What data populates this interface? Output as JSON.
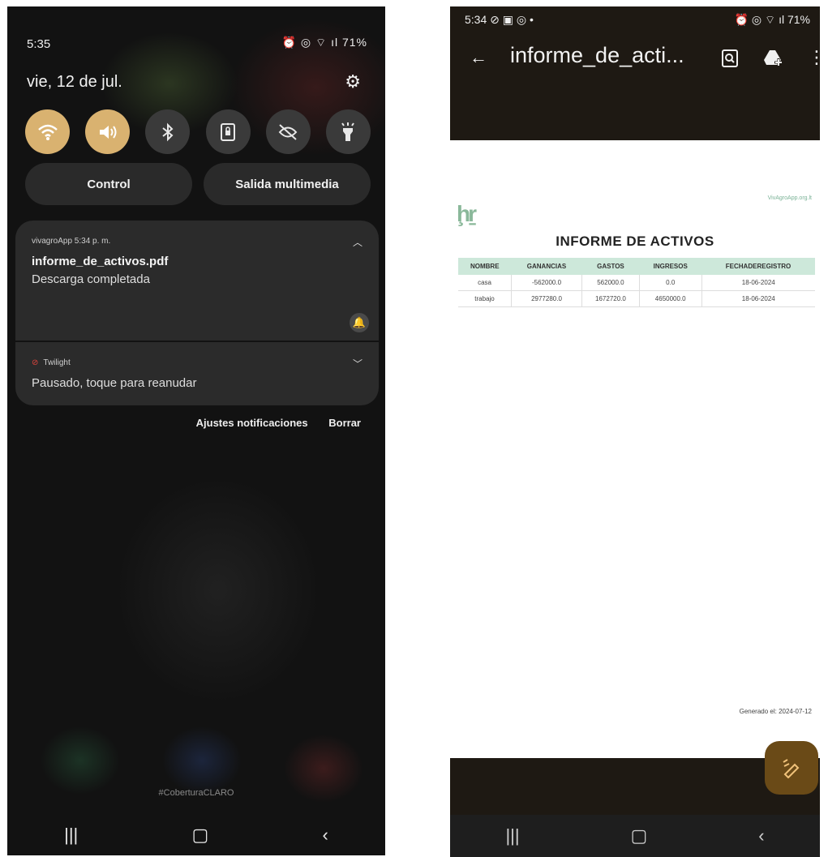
{
  "left": {
    "status": {
      "time": "5:35",
      "right": "⏰ ◎ ⌔ ıl 71%"
    },
    "date": "vie, 12 de jul.",
    "quick_settings": [
      "wifi",
      "sound",
      "bluetooth",
      "rotation",
      "eye",
      "flashlight"
    ],
    "buttons": {
      "control": "Control",
      "media": "Salida multimedia"
    },
    "notifications": [
      {
        "app": "vivagroApp 5:34 p. m.",
        "title": "informe_de_activos.pdf",
        "body": "Descarga completada"
      },
      {
        "app": "Twilight",
        "body": "Pausado, toque para reanudar"
      }
    ],
    "actions": {
      "settings": "Ajustes notificaciones",
      "clear": "Borrar"
    },
    "carrier": "#CoberturaCLARO"
  },
  "right": {
    "status": {
      "time": "5:34 ⊘ ▣ ◎ •",
      "right": "⏰ ◎ ⌔ ıl 71%"
    },
    "toolbar_title": "informe_de_acti...",
    "doc": {
      "logo": "ḩṟ",
      "site": "VivAgroApp.org.lt",
      "title": "INFORME DE ACTIVOS",
      "headers": [
        "NOMBRE",
        "GANANCIAS",
        "GASTOS",
        "INGRESOS",
        "FECHADEREGISTRO"
      ],
      "rows": [
        [
          "casa",
          "-562000.0",
          "562000.0",
          "0.0",
          "18-06-2024"
        ],
        [
          "trabajo",
          "2977280.0",
          "1672720.0",
          "4650000.0",
          "18-06-2024"
        ]
      ],
      "generated": "Generado el: 2024-07-12"
    }
  },
  "colors": {
    "accent": "#d9b270",
    "tableHeader": "#cde8da",
    "fab": "#6a4a17"
  }
}
